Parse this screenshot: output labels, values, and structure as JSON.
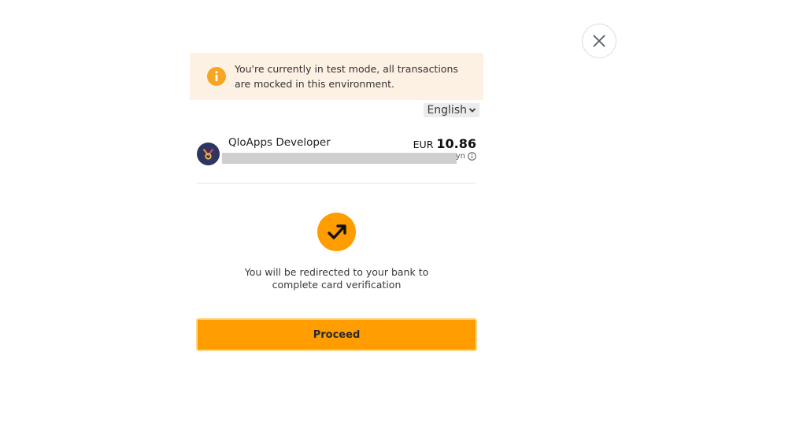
{
  "close": {
    "icon": "close-icon"
  },
  "banner": {
    "icon": "info-icon",
    "line1": "You're currently in test mode, all transactions",
    "line2": "are mocked in this environment."
  },
  "language": {
    "selected": "English",
    "icon": "chevron-down-icon"
  },
  "merchant": {
    "name": "QloApps Developer",
    "currency": "EUR",
    "amount": "10.86",
    "tax_tail": "yn",
    "logo_icon": "merchant-logo-icon",
    "tax_icon": "info-circle-icon"
  },
  "verification": {
    "icon": "redirect-arrow-icon",
    "line1": "You will be redirected to your bank to",
    "line2": "complete card verification"
  },
  "proceed": {
    "label": "Proceed"
  },
  "colors": {
    "accent": "#ff9d00",
    "banner_bg": "#fdf1e4",
    "logo_bg": "#2e3560",
    "info_icon": "#f6a623"
  }
}
